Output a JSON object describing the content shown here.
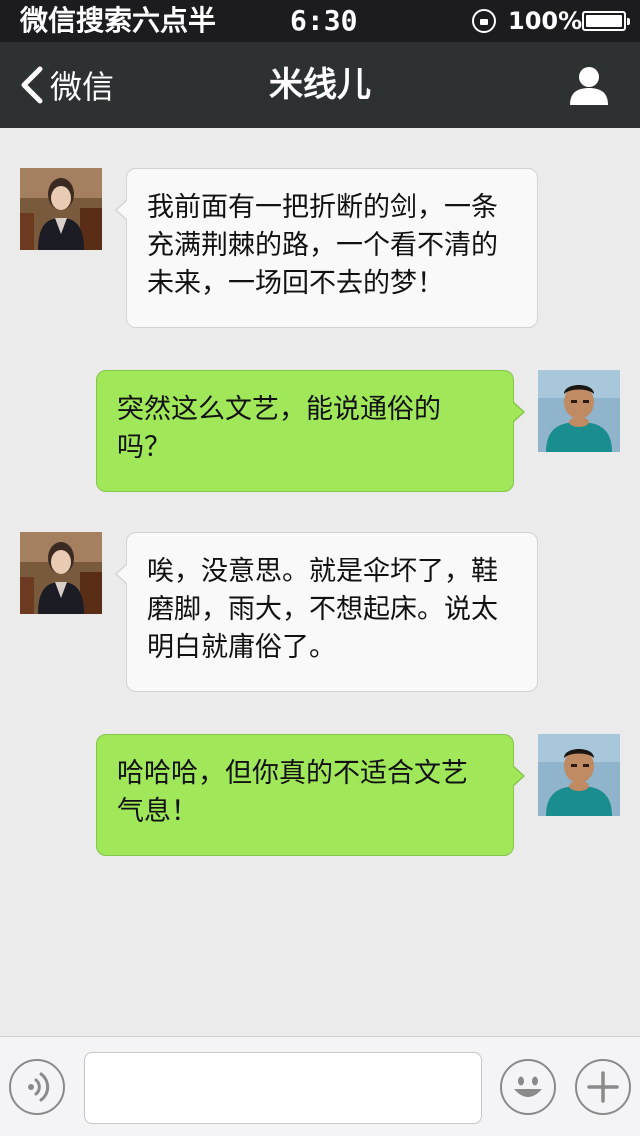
{
  "status_bar": {
    "carrier": "微信搜索六点半",
    "time": "6:30",
    "battery": "100%"
  },
  "nav": {
    "back_label": "微信",
    "title": "米线儿"
  },
  "messages": [
    {
      "side": "left",
      "text": "我前面有一把折断的剑，一条充满荆棘的路，一个看不清的未来，一场回不去的梦！"
    },
    {
      "side": "right",
      "text": "突然这么文艺，能说通俗的吗？"
    },
    {
      "side": "left",
      "text": "唉，没意思。就是伞坏了，鞋磨脚，雨大，不想起床。说太明白就庸俗了。"
    },
    {
      "side": "right",
      "text": "哈哈哈，但你真的不适合文艺气息！"
    }
  ],
  "input": {
    "value": "",
    "placeholder": ""
  },
  "icons": {
    "back": "chevron-left-icon",
    "profile": "person-icon",
    "voice": "voice-icon",
    "emoji": "emoji-icon",
    "plus": "plus-icon",
    "lock": "rotation-lock-icon",
    "battery": "battery-icon"
  },
  "colors": {
    "nav_bg": "#2e3132",
    "status_bg": "#1c1c1e",
    "chat_bg": "#ebebeb",
    "incoming_bubble": "#f9f9f9",
    "outgoing_bubble": "#a0e75a"
  }
}
